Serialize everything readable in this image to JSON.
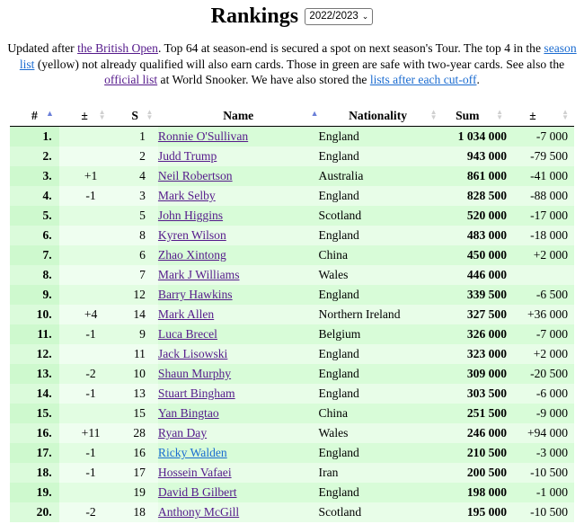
{
  "header": {
    "title": "Rankings",
    "season_selected": "2022/2023",
    "chevron": "⌄"
  },
  "intro": {
    "t1": "Updated after ",
    "link1": "the British Open",
    "t2": ". Top 64 at season-end is secured a spot on next season's Tour. The top 4 in the ",
    "link2": "season list",
    "t3": " (yellow) not already qualified will also earn cards. Those in green are safe with two-year cards. See also the ",
    "link3": "official list",
    "t4": " at World Snooker. We have also stored the ",
    "link4": "lists after each cut-off",
    "t5": "."
  },
  "table": {
    "columns": [
      "#",
      "±",
      "S",
      "Name",
      "Nationality",
      "Sum",
      "±"
    ],
    "sort_icons": {
      "active": "▲",
      "idle": "⬍"
    },
    "rows": [
      {
        "pos": "1.",
        "chg": "",
        "s": "1",
        "name": "Ronnie O'Sullivan",
        "nat": "England",
        "sum": "1 034 000",
        "diff": "-7 000",
        "link": "visited"
      },
      {
        "pos": "2.",
        "chg": "",
        "s": "2",
        "name": "Judd Trump",
        "nat": "England",
        "sum": "943 000",
        "diff": "-79 500",
        "link": "visited"
      },
      {
        "pos": "3.",
        "chg": "+1",
        "s": "4",
        "name": "Neil Robertson",
        "nat": "Australia",
        "sum": "861 000",
        "diff": "-41 000",
        "link": "visited"
      },
      {
        "pos": "4.",
        "chg": "-1",
        "s": "3",
        "name": "Mark Selby",
        "nat": "England",
        "sum": "828 500",
        "diff": "-88 000",
        "link": "visited"
      },
      {
        "pos": "5.",
        "chg": "",
        "s": "5",
        "name": "John Higgins",
        "nat": "Scotland",
        "sum": "520 000",
        "diff": "-17 000",
        "link": "visited"
      },
      {
        "pos": "6.",
        "chg": "",
        "s": "8",
        "name": "Kyren Wilson",
        "nat": "England",
        "sum": "483 000",
        "diff": "-18 000",
        "link": "visited"
      },
      {
        "pos": "7.",
        "chg": "",
        "s": "6",
        "name": "Zhao Xintong",
        "nat": "China",
        "sum": "450 000",
        "diff": "+2 000",
        "link": "visited"
      },
      {
        "pos": "8.",
        "chg": "",
        "s": "7",
        "name": "Mark J Williams",
        "nat": "Wales",
        "sum": "446 000",
        "diff": "",
        "link": "visited"
      },
      {
        "pos": "9.",
        "chg": "",
        "s": "12",
        "name": "Barry Hawkins",
        "nat": "England",
        "sum": "339 500",
        "diff": "-6 500",
        "link": "visited"
      },
      {
        "pos": "10.",
        "chg": "+4",
        "s": "14",
        "name": "Mark Allen",
        "nat": "Northern Ireland",
        "sum": "327 500",
        "diff": "+36 000",
        "link": "visited"
      },
      {
        "pos": "11.",
        "chg": "-1",
        "s": "9",
        "name": "Luca Brecel",
        "nat": "Belgium",
        "sum": "326 000",
        "diff": "-7 000",
        "link": "visited"
      },
      {
        "pos": "12.",
        "chg": "",
        "s": "11",
        "name": "Jack Lisowski",
        "nat": "England",
        "sum": "323 000",
        "diff": "+2 000",
        "link": "visited"
      },
      {
        "pos": "13.",
        "chg": "-2",
        "s": "10",
        "name": "Shaun Murphy",
        "nat": "England",
        "sum": "309 000",
        "diff": "-20 500",
        "link": "visited"
      },
      {
        "pos": "14.",
        "chg": "-1",
        "s": "13",
        "name": "Stuart Bingham",
        "nat": "England",
        "sum": "303 500",
        "diff": "-6 000",
        "link": "visited"
      },
      {
        "pos": "15.",
        "chg": "",
        "s": "15",
        "name": "Yan Bingtao",
        "nat": "China",
        "sum": "251 500",
        "diff": "-9 000",
        "link": "visited"
      },
      {
        "pos": "16.",
        "chg": "+11",
        "s": "28",
        "name": "Ryan Day",
        "nat": "Wales",
        "sum": "246 000",
        "diff": "+94 000",
        "link": "visited"
      },
      {
        "pos": "17.",
        "chg": "-1",
        "s": "16",
        "name": "Ricky Walden",
        "nat": "England",
        "sum": "210 500",
        "diff": "-3 000",
        "link": "unvisited"
      },
      {
        "pos": "18.",
        "chg": "-1",
        "s": "17",
        "name": "Hossein Vafaei",
        "nat": "Iran",
        "sum": "200 500",
        "diff": "-10 500",
        "link": "visited"
      },
      {
        "pos": "19.",
        "chg": "",
        "s": "19",
        "name": "David B Gilbert",
        "nat": "England",
        "sum": "198 000",
        "diff": "-1 000",
        "link": "visited"
      },
      {
        "pos": "20.",
        "chg": "-2",
        "s": "18",
        "name": "Anthony McGill",
        "nat": "Scotland",
        "sum": "195 000",
        "diff": "-10 500",
        "link": "visited"
      }
    ]
  },
  "colors": {
    "visited_link": "#551a8b",
    "unvisited_link": "#1a6bd0",
    "row_green_dark": "#d8fcd8",
    "row_green_light": "#e8fde8",
    "sort_active": "#6a7fd8"
  }
}
